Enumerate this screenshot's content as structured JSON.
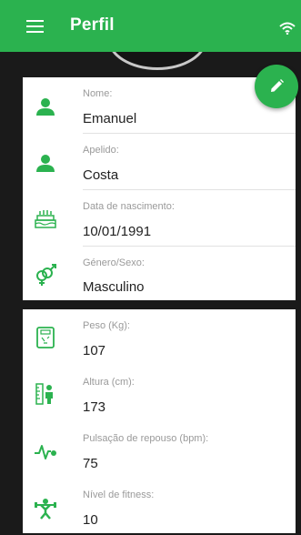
{
  "appbar": {
    "title": "Perfil",
    "menu_icon": "menu-icon",
    "wifi_icon": "wifi-icon"
  },
  "profile": {
    "name_label": "Nome:",
    "name_value": "Emanuel",
    "surname_label": "Apelido:",
    "surname_value": "Costa",
    "birth_label": "Data de nascimento:",
    "birth_value": "10/01/1991",
    "gender_label": "Género/Sexo:",
    "gender_value": "Masculino"
  },
  "fitness": {
    "weight_label": "Peso (Kg):",
    "weight_value": "107",
    "height_label": "Altura (cm):",
    "height_value": "173",
    "pulse_label": "Pulsação de repouso (bpm):",
    "pulse_value": "75",
    "fitness_label": "Nível de fitness:",
    "fitness_value": "10"
  },
  "colors": {
    "accent": "#2bb24f",
    "background": "#1a1a1a"
  },
  "fab": {
    "icon": "edit-pencil-icon"
  }
}
